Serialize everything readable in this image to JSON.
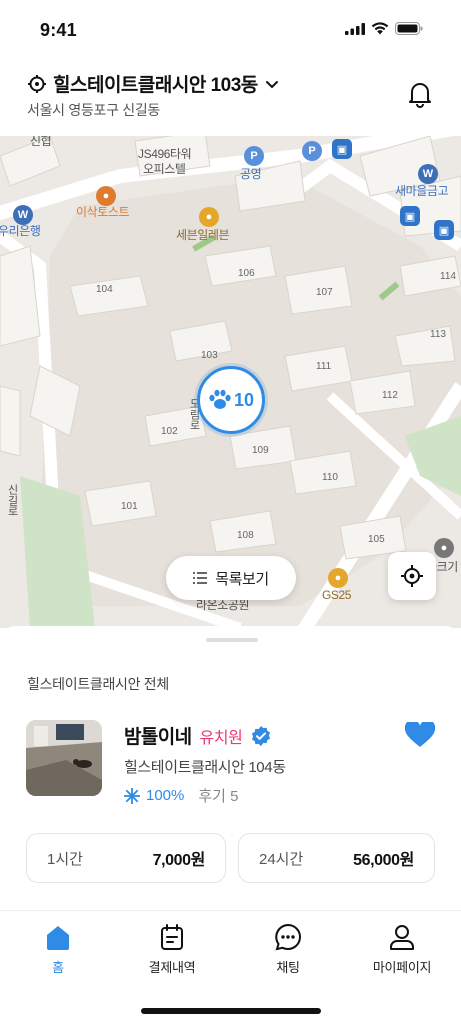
{
  "status": {
    "time": "9:41"
  },
  "header": {
    "location_title": "힐스테이트클래시안 103동",
    "location_sub": "서울시 영등포구 신길동"
  },
  "map": {
    "buildings": [
      "104",
      "106",
      "107",
      "114",
      "103",
      "111",
      "113",
      "112",
      "102",
      "109",
      "110",
      "101",
      "108",
      "105"
    ],
    "pois": {
      "js": "JS496타워",
      "js2": "오피스텔",
      "park": "공영",
      "isaac": "이삭토스트",
      "seven": "세븐일레븐",
      "bank": "우리은행",
      "saemaeul": "새마을금고",
      "gs": "GS25",
      "park2": "파크기",
      "shingil": "신길로",
      "ramon": "라온소공원",
      "sinhap": "신협",
      "road": "도림로"
    },
    "cluster_count": "10",
    "list_button_label": "목록보기"
  },
  "sheet": {
    "title": "힐스테이트클래시안 전체",
    "card": {
      "name": "밤톨이네",
      "kind": "유치원",
      "address": "힐스테이트클래시안 104동",
      "rate": "100%",
      "review": "후기 5"
    },
    "prices": [
      {
        "label": "1시간",
        "value": "7,000원"
      },
      {
        "label": "24시간",
        "value": "56,000원"
      }
    ]
  },
  "tabs": [
    {
      "label": "홈",
      "icon": "home-icon"
    },
    {
      "label": "결제내역",
      "icon": "calendar-icon"
    },
    {
      "label": "채팅",
      "icon": "chat-icon"
    },
    {
      "label": "마이페이지",
      "icon": "user-icon"
    }
  ],
  "colors": {
    "accent": "#2f8be6",
    "kind": "#ea3b6e"
  }
}
